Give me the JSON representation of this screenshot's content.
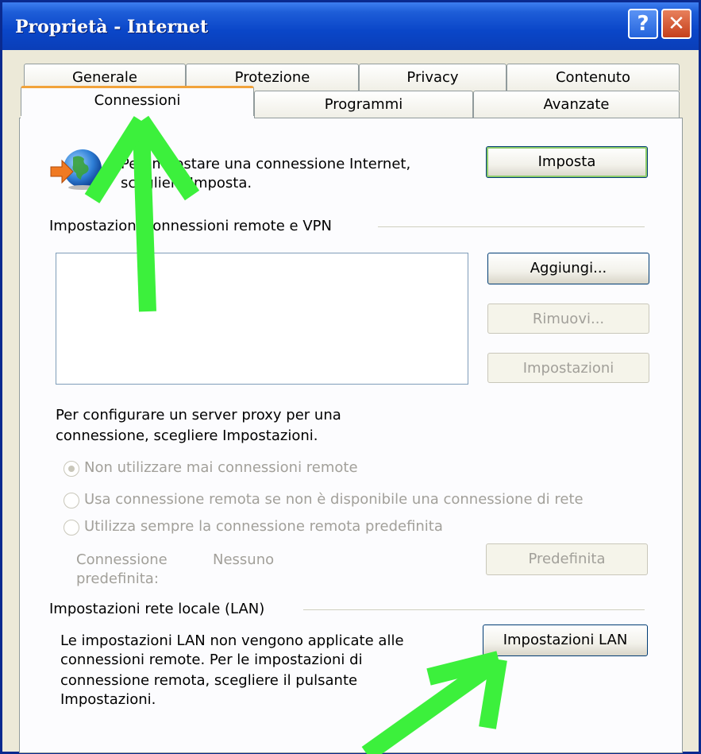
{
  "window": {
    "title": "Proprietà - Internet",
    "help_label": "?",
    "close_label": "✕"
  },
  "tabs_back": [
    "Generale",
    "Protezione",
    "Privacy",
    "Contenuto"
  ],
  "tabs_front": [
    "Connessioni",
    "Programmi",
    "Avanzate"
  ],
  "active_tab": "Connessioni",
  "setup": {
    "line1": "Per impostare una connessione Internet,",
    "line2": "scegliere Imposta.",
    "button": "Imposta"
  },
  "remote": {
    "group_label": "Impostazioni connessioni remote e VPN",
    "list_items": [],
    "add_button": "Aggiungi...",
    "remove_button": "Rimuovi...",
    "settings_button": "Impostazioni",
    "proxy_line1": "Per configurare un server proxy per una",
    "proxy_line2": "connessione, scegliere Impostazioni.",
    "radio_never": "Non utilizzare mai connessioni remote",
    "radio_when_no_net": "Usa connessione remota se non è disponibile una connessione di rete",
    "radio_always": "Utilizza sempre la connessione remota predefinita",
    "selected_radio": "Non utilizzare mai connessioni remote",
    "default_conn_label1": "Connessione",
    "default_conn_label2": "predefinita:",
    "default_conn_value": "Nessuno",
    "default_button": "Predefinita"
  },
  "lan": {
    "group_label": "Impostazioni rete locale (LAN)",
    "line1": "Le impostazioni LAN non vengono applicate alle",
    "line2": "connessioni remote. Per le impostazioni di",
    "line3": "connessione remota, scegliere il pulsante",
    "line4": "Impostazioni.",
    "button": "Impostazioni LAN"
  },
  "colors": {
    "title_bar": "#0a46c8",
    "dialog_bg": "#ece9d8",
    "active_tab_accent": "#f1a33a",
    "annotation_arrow": "#3cf03c",
    "disabled_text": "#a2a09a"
  },
  "icons": {
    "connection": "globe-with-arrow-icon",
    "annotations": [
      "green-arrow-up-icon",
      "green-arrow-diagonal-icon"
    ]
  }
}
